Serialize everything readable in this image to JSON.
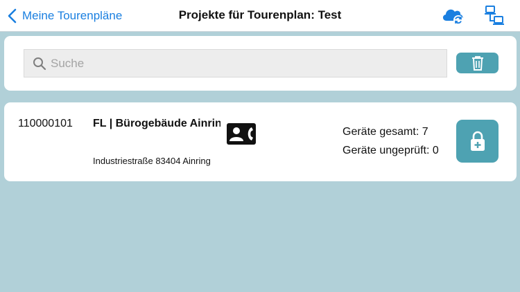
{
  "navbar": {
    "back_label": "Meine Tourenpläne",
    "title": "Projekte für Tourenplan: Test",
    "icons": [
      "chevron-left-icon",
      "cloud-sync-icon",
      "network-icon"
    ]
  },
  "search": {
    "placeholder": "Suche",
    "value": "",
    "delete_icon": "trash-icon"
  },
  "projects": [
    {
      "number": "110000101",
      "name": "FL | Bürogebäude Ainrin",
      "address": "Industriestraße  83404  Ainring",
      "contact_icon": "contact-phone-icon",
      "devices_total": "Geräte gesamt: 7",
      "devices_unchecked": "Geräte ungeprüft: 0",
      "action_icon": "lock-plus-icon"
    }
  ],
  "colors": {
    "accent": "#1a7fe0",
    "button": "#4ea2b2",
    "background": "#b1d0d8",
    "card": "#ffffff"
  }
}
